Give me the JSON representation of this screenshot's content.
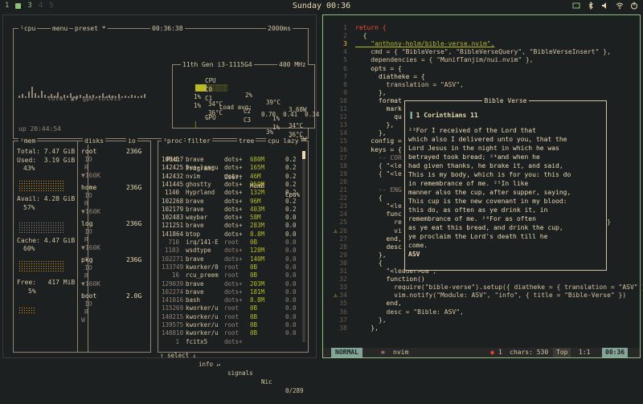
{
  "topbar": {
    "workspaces": [
      "1",
      "3",
      "4",
      "5"
    ],
    "active_workspace": "3",
    "clock": "Sunday 00:36",
    "tray_icons": [
      "window-icon",
      "bluetooth-icon",
      "volume-icon",
      "wifi-icon",
      "power-icon"
    ]
  },
  "btop": {
    "cpu_tab": "¹cpu",
    "menu": "menu",
    "preset": "preset *",
    "uptime_clock": "00:36:38",
    "refresh": "2000ms",
    "cpu_name": "11th Gen i3-1115G4",
    "freq": "400 MHz",
    "cpu_rows": [
      {
        "label": "CPU",
        "bar": "███░░░░░░",
        "pct": "2%",
        "temp": "39°C",
        "watt": "3.68W"
      },
      {
        "label": "C0",
        "pct": "1%",
        "temp": "34°C",
        "c2": "C2",
        "pct2": "1%",
        "temp2": "34°C"
      },
      {
        "label": "C1",
        "pct": "1%",
        "temp": "36°C",
        "c2": "C3",
        "pct2": "1%",
        "temp2": "36°C"
      }
    ],
    "load_avg_label": "Load avg:",
    "load_avg": "0.70  0.41  0.34",
    "gpu_label": "GPU",
    "gpu_pct": "3%",
    "gpu_watt": "0.15W",
    "totals_label": "total ▲▼ gpu-totals",
    "uptime": "up 20:44:54",
    "mem_tab": "²mem",
    "mem": {
      "total": "Total: 7.47 GiB",
      "used": "Used:  3.19 GiB",
      "used_pct": "43%",
      "avail": "Avail: 4.28 GiB",
      "avail_pct": "57%",
      "cache": "Cache: 4.47 GiB",
      "cache_pct": "60%",
      "free": "Free:   417 MiB",
      "free_pct": "5%"
    },
    "disks_tab": "disks",
    "io_tab": "io",
    "disks": [
      {
        "name": "root",
        "size": "236G",
        "io": "IO",
        "r": "R",
        "w": "▼160K"
      },
      {
        "name": "home",
        "size": "236G",
        "io": "IO",
        "r": "R",
        "w": "▼160K"
      },
      {
        "name": "log",
        "size": "236G",
        "io": "IO",
        "r": "R",
        "w": "▼160K"
      },
      {
        "name": "pkg",
        "size": "236G",
        "io": "IO",
        "r": "R",
        "w": "▼160K"
      },
      {
        "name": "boot",
        "size": "2.0G",
        "io": "IO",
        "r": "R",
        "w": "W"
      }
    ],
    "proc_tab": "³proc",
    "filter": "filter",
    "tree": "tree",
    "sort": "cpu lazy",
    "proc_header": {
      "pid": "Pid:",
      "program": "Program:",
      "user": "User:",
      "mem": "MemB",
      "cpu": "Cpu%"
    },
    "procs": [
      [
        "108417",
        "brave",
        "dots+",
        "680M",
        "0.2"
      ],
      [
        "142425",
        "lua-langu",
        "dots+",
        "165M",
        "0.2"
      ],
      [
        "142432",
        "nvim",
        "dots+",
        "46M",
        "0.2"
      ],
      [
        "141445",
        "ghostty",
        "dots+",
        "259M",
        "0.2"
      ],
      [
        "1140",
        "Hyprland",
        "dots+",
        "132M",
        "0.2"
      ],
      [
        "102268",
        "brave",
        "dots+",
        "96M",
        "0.2"
      ],
      [
        "102179",
        "brave",
        "dots+",
        "403M",
        "0.2"
      ],
      [
        "102483",
        "waybar",
        "dots+",
        "58M",
        "0.0"
      ],
      [
        "121251",
        "brave",
        "dots+",
        "283M",
        "0.0"
      ],
      [
        "141864",
        "btop",
        "dots+",
        "8.8M",
        "0.0"
      ],
      [
        "710",
        "irq/141-E",
        "root",
        "0B",
        "0.0"
      ],
      [
        "1183",
        "wsdtype",
        "dots+",
        "128M",
        "0.0"
      ],
      [
        "102271",
        "brave",
        "dots+",
        "140M",
        "0.0"
      ],
      [
        "133749",
        "kworker/0",
        "root",
        "0B",
        "0.0"
      ],
      [
        "16",
        "rcu_preem",
        "root",
        "0B",
        "0.0"
      ],
      [
        "129039",
        "brave",
        "dots+",
        "203M",
        "0.0"
      ],
      [
        "102274",
        "brave",
        "dots+",
        "181M",
        "0.0"
      ],
      [
        "141016",
        "bash",
        "dots+",
        "8.8M",
        "0.0"
      ],
      [
        "115269",
        "kworker/u",
        "root",
        "0B",
        "0.0"
      ],
      [
        "140215",
        "kworker/u",
        "root",
        "0B",
        "0.0"
      ],
      [
        "139575",
        "kworker/u",
        "root",
        "0B",
        "0.0"
      ],
      [
        "140810",
        "kworker/u",
        "root",
        "0B",
        "0.0"
      ],
      [
        "1",
        "fcitx5",
        "dots+",
        "",
        ""
      ]
    ],
    "proc_footer": {
      "select": "↑ select ↓",
      "info": "info ↵",
      "signals": "signals",
      "nice": "Nic",
      "count": "0/289"
    }
  },
  "nvim": {
    "lines": [
      {
        "n": "1",
        "t": "return {"
      },
      {
        "n": "2",
        "t": "  {"
      },
      {
        "n": "3",
        "t": "    \"anthony-holm/bible-verse.nvim\","
      },
      {
        "n": "4",
        "t": "    cmd = { \"BibleVerse\", \"BibleVerseQuery\", \"BibleVerseInsert\" },"
      },
      {
        "n": "5",
        "t": "    dependencies = { \"MunifTanjim/nui.nvim\" },"
      },
      {
        "n": "6",
        "t": "    opts = {"
      },
      {
        "n": "7",
        "t": "      diatheke = {"
      },
      {
        "n": "8",
        "t": "        translation = \"ASV\","
      },
      {
        "n": "9",
        "t": "      },"
      },
      {
        "n": "10",
        "t": "      format"
      },
      {
        "n": "11",
        "t": "        mark"
      },
      {
        "n": "12",
        "t": "          qu"
      },
      {
        "n": "13",
        "t": "        },"
      },
      {
        "n": "14",
        "t": "      },"
      },
      {
        "n": "15",
        "t": "    config ="
      },
      {
        "n": "16",
        "t": "    keys = {"
      },
      {
        "n": "17",
        "t": "      -- COR"
      },
      {
        "n": "18",
        "t": "      { \"<le                                 Query Module\" },"
      },
      {
        "n": "19",
        "t": "      { \"<le                                 \"Insert Output\" },"
      },
      {
        "n": "20",
        "t": ""
      },
      {
        "n": "21",
        "t": "      -- ENG"
      },
      {
        "n": "22",
        "t": "      {"
      },
      {
        "n": "23",
        "t": "        \"<le"
      },
      {
        "n": "24",
        "t": "        func"
      },
      {
        "n": "25",
        "t": "          re                               translation = \"KJV\" } }"
      },
      {
        "n": "26",
        "t": "          vi                               le-Verse\" }"
      },
      {
        "n": "27",
        "t": "        end,"
      },
      {
        "n": "28",
        "t": "        desc"
      },
      {
        "n": "29",
        "t": "      },"
      },
      {
        "n": "30",
        "t": "      {"
      },
      {
        "n": "31",
        "t": "        \"<leader>ba\","
      },
      {
        "n": "32",
        "t": "        function()"
      },
      {
        "n": "33",
        "t": "          require(\"bible-verse\").setup({ diatheke = { translation = \"ASV\" } })"
      },
      {
        "n": "34",
        "t": "          vim.notify(\"Module: ASV\", \"info\", { title = \"Bible-Verse\" })"
      },
      {
        "n": "35",
        "t": "        end,"
      },
      {
        "n": "36",
        "t": "        desc = \"Bible: ASV\","
      },
      {
        "n": "37",
        "t": "      },"
      },
      {
        "n": "38",
        "t": "    },"
      }
    ],
    "popup": {
      "title": "Bible Verse",
      "heading": "1 Corinthians 11",
      "body": "²³For I received of the Lord that\nwhich also I delivered unto you, that the\nLord Jesus in the night in which he was\nbetrayed took bread; ²⁴and when he\nhad given thanks, he brake it, and said,\nThis is my body, which is for you: this do\nin remembrance of me. ²⁵In like\nmanner also the cup, after supper, saying,\nThis cup is the new covenant in my blood:\nthis do, as often as ye drink it, in\nremembrance of me. ²⁶For as often\nas ye eat this bread, and drink the cup,\nye proclaim the Lord's death till he\ncome.",
      "footer": "ASV"
    },
    "status": {
      "mode": "NORMAL",
      "filetype": "nvim",
      "diag": "1",
      "chars": "chars: 530",
      "position": "Top",
      "line": "1:1",
      "time": "00:36"
    }
  }
}
